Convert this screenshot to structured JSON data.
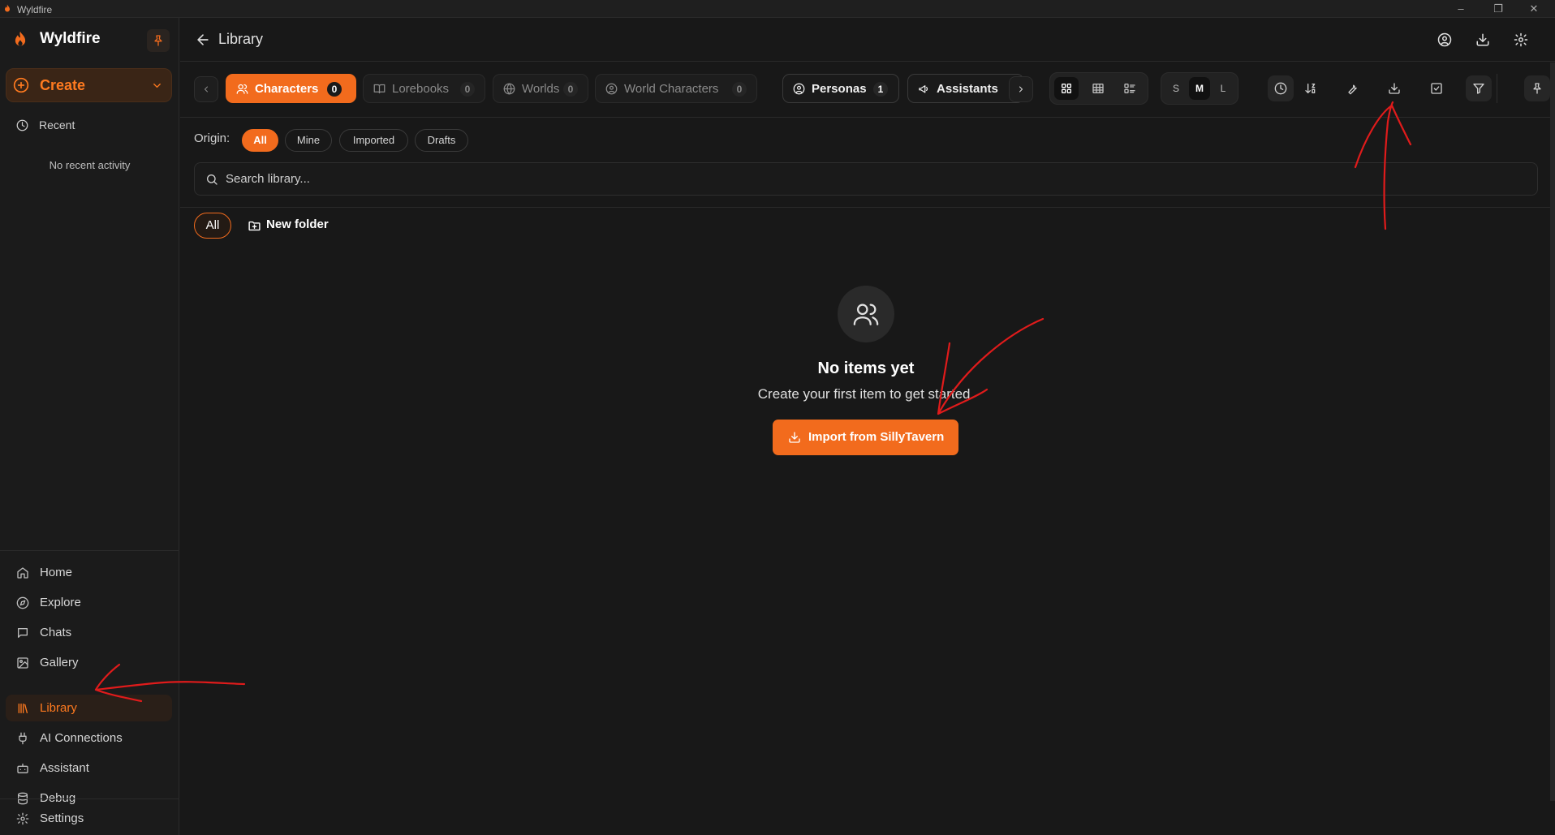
{
  "window": {
    "title": "Wyldfire",
    "controls": {
      "minimize": "–",
      "restore": "❐",
      "close": "✕"
    }
  },
  "sidebar": {
    "brand": "Wyldfire",
    "create_label": "Create",
    "recent_label": "Recent",
    "no_recent": "No recent activity",
    "nav": [
      {
        "label": "Home",
        "icon": "home-icon"
      },
      {
        "label": "Explore",
        "icon": "compass-icon"
      },
      {
        "label": "Chats",
        "icon": "chat-icon"
      },
      {
        "label": "Gallery",
        "icon": "image-icon"
      },
      {
        "label": "Library",
        "icon": "library-icon",
        "active": true
      },
      {
        "label": "AI Connections",
        "icon": "plug-icon"
      },
      {
        "label": "Assistant",
        "icon": "bot-icon"
      },
      {
        "label": "Debug",
        "icon": "database-icon"
      },
      {
        "label": "Settings",
        "icon": "gear-icon"
      }
    ]
  },
  "header": {
    "title": "Library"
  },
  "tabs": [
    {
      "label": "Characters",
      "count": "0",
      "state": "active"
    },
    {
      "label": "Lorebooks",
      "count": "0",
      "state": "dim"
    },
    {
      "label": "Worlds",
      "count": "0",
      "state": "dim"
    },
    {
      "label": "World Characters",
      "count": "0",
      "state": "dim"
    },
    {
      "label": "Personas",
      "count": "1",
      "state": "on"
    },
    {
      "label": "Assistants",
      "count": "",
      "state": "on"
    }
  ],
  "size_options": [
    "S",
    "M",
    "L"
  ],
  "selected_size": "M",
  "filter": {
    "origin_label": "Origin:",
    "options": [
      "All",
      "Mine",
      "Imported",
      "Drafts"
    ],
    "selected": "All"
  },
  "search": {
    "placeholder": "Search library..."
  },
  "folders": {
    "all_label": "All",
    "new_folder_label": "New folder"
  },
  "empty_state": {
    "title": "No items yet",
    "subtitle": "Create your first item to get started.",
    "button_label": "Import from SillyTavern"
  },
  "colors": {
    "accent": "#f26b1d",
    "background": "#181818",
    "annotation": "#e01b1b"
  }
}
